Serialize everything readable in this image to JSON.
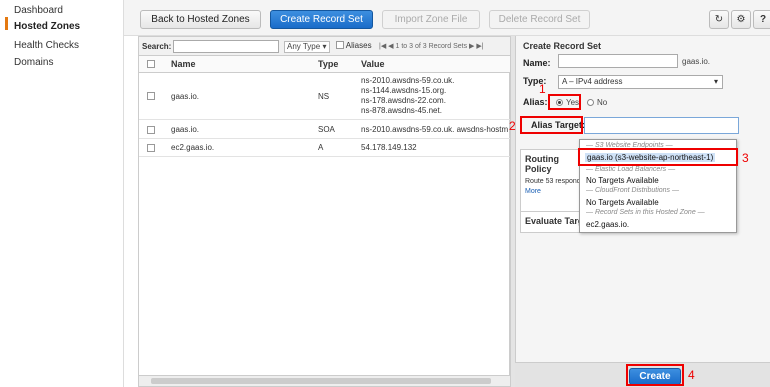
{
  "nav": {
    "items": [
      {
        "label": "Dashboard"
      },
      {
        "label": "Hosted Zones"
      },
      {
        "label": "Health Checks"
      },
      {
        "label": "Domains"
      }
    ]
  },
  "toolbar": {
    "back_label": "Back to Hosted Zones",
    "create_label": "Create Record Set",
    "import_label": "Import Zone File",
    "delete_label": "Delete Record Set",
    "refresh_icon": "refresh-icon",
    "settings_icon": "gear-icon",
    "help_icon": "help-icon"
  },
  "search": {
    "label": "Search:",
    "placeholder": "",
    "type_select": "Any Type",
    "aliases_label": "Aliases",
    "pager_text": "1 to 3 of 3 Record Sets"
  },
  "table": {
    "headers": [
      "Name",
      "Type",
      "Value"
    ],
    "rows": [
      {
        "name": "gaas.io.",
        "type": "NS",
        "values": [
          "ns-2010.awsdns-59.co.uk.",
          "ns-1144.awsdns-15.org.",
          "ns-178.awsdns-22.com.",
          "ns-878.awsdns-45.net."
        ]
      },
      {
        "name": "gaas.io.",
        "type": "SOA",
        "values": [
          "ns-2010.awsdns-59.co.uk. awsdns-hostm"
        ]
      },
      {
        "name": "ec2.gaas.io.",
        "type": "A",
        "values": [
          "54.178.149.132"
        ]
      }
    ]
  },
  "form": {
    "title": "Create Record Set",
    "name_label": "Name:",
    "name_suffix": "gaas.io.",
    "type_label": "Type:",
    "type_value": "A – IPv4 address",
    "alias_label": "Alias:",
    "alias_yes": "Yes",
    "alias_no": "No",
    "alias_target_label": "Alias Target:",
    "routing_label": "Routing Policy",
    "routing_text": "Route 53 respond",
    "routing_more": "More",
    "evaluate_label": "Evaluate Targe",
    "create_label": "Create"
  },
  "dropdown": {
    "group_s3": "— S3 Website Endpoints —",
    "item_s3": "gaas.io (s3-website-ap-northeast-1)",
    "group_elb": "— Elastic Load Balancers —",
    "item_elb": "No Targets Available",
    "group_cf": "— CloudFront Distributions —",
    "item_cf": "No Targets Available",
    "group_rs": "— Record Sets in this Hosted Zone —",
    "item_rs": "ec2.gaas.io."
  },
  "annotations": {
    "n1": "1",
    "n2": "2",
    "n3": "3",
    "n4": "4",
    "color": "#e00000"
  }
}
